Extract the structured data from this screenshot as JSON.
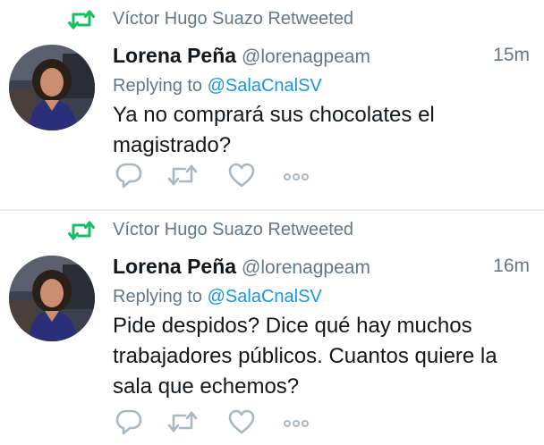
{
  "tweets": [
    {
      "retweeted_by": "Víctor Hugo Suazo Retweeted",
      "name": "Lorena Peña",
      "handle": "@lorenagpeam",
      "time": "15m",
      "replying_prefix": "Replying to",
      "replying_to": "@SalaCnalSV",
      "text": "Ya no comprará sus chocolates el magistrado?"
    },
    {
      "retweeted_by": "Víctor Hugo Suazo Retweeted",
      "name": "Lorena Peña",
      "handle": "@lorenagpeam",
      "time": "16m",
      "replying_prefix": "Replying to",
      "replying_to": "@SalaCnalSV",
      "text": "Pide despidos? Dice qué hay muchos trabajadores públicos. Cuantos quiere la sala que echemos?"
    }
  ],
  "icons": {
    "retweet_indicator": "retweet-icon",
    "reply": "reply-icon",
    "retweet": "retweet-icon",
    "like": "heart-icon",
    "more": "more-icon"
  },
  "colors": {
    "retweet_green": "#17bf63",
    "secondary_text": "#657786",
    "link_blue": "#1b95e0",
    "primary_text": "#14171a",
    "action_gray": "#aab8c2",
    "divider": "#e6ecf0"
  }
}
